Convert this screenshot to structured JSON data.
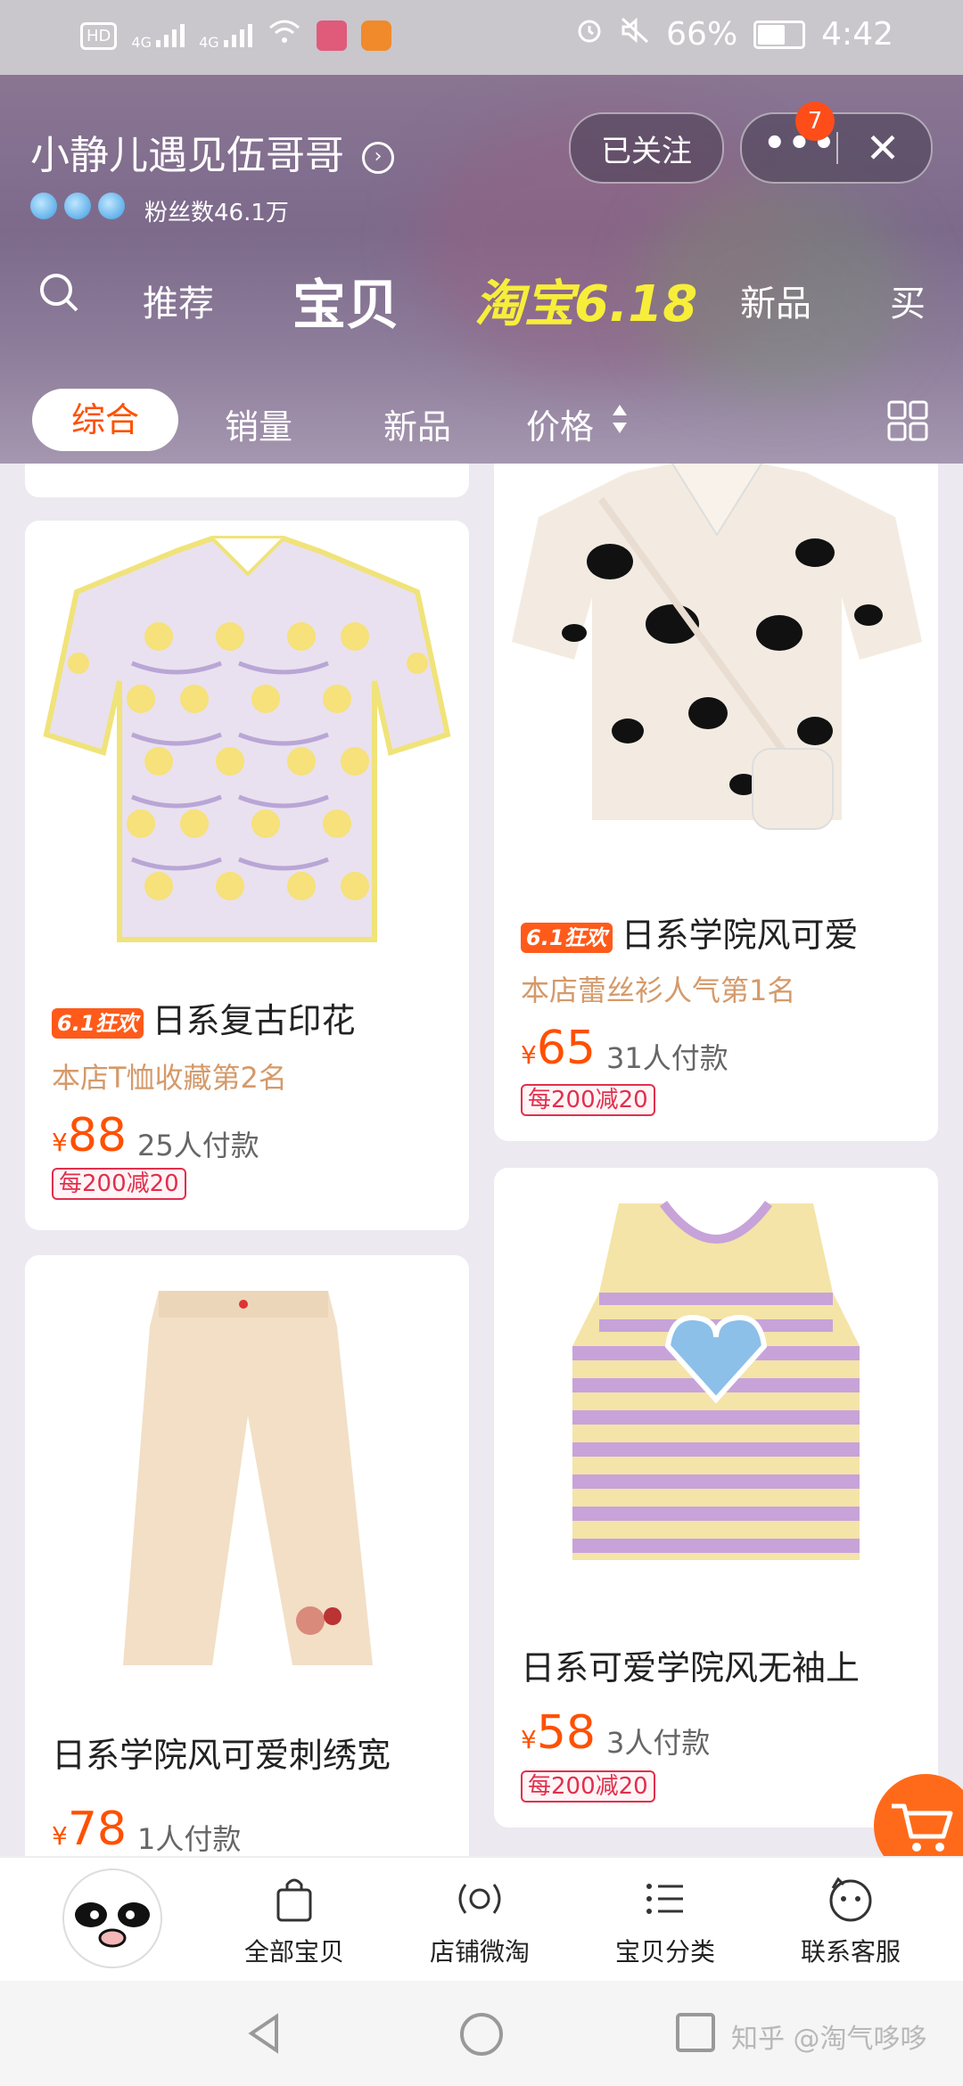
{
  "status_bar": {
    "hd": "HD",
    "net1": "4G",
    "net2": "4G",
    "battery": "66%",
    "time": "4:42"
  },
  "shop": {
    "name": "小静儿遇见伍哥哥",
    "fans": "粉丝数46.1万",
    "follow_label": "已关注",
    "more_label": "•••",
    "badge_count": "7",
    "close_label": "✕"
  },
  "tabs": {
    "recommend": "推荐",
    "products": "宝贝",
    "event": "淘宝6.18",
    "new": "新品",
    "buy": "买"
  },
  "sort": {
    "overall": "综合",
    "sales": "销量",
    "new": "新品",
    "price": "价格"
  },
  "products": [
    {
      "promo": "6.1狂欢",
      "title": "日系复古印花",
      "rank": "本店T恤收藏第2名",
      "price": "88",
      "pay": "25人付款",
      "coupon": "每200减20"
    },
    {
      "promo": "6.1狂欢",
      "title": "日系学院风可爱",
      "rank": "本店蕾丝衫人气第1名",
      "price": "65",
      "pay": "31人付款",
      "coupon": "每200减20"
    },
    {
      "title": "日系学院风可爱刺绣宽",
      "price": "78",
      "pay": "1人付款"
    },
    {
      "title": "日系可爱学院风无袖上",
      "price": "58",
      "pay": "3人付款",
      "coupon": "每200减20"
    }
  ],
  "currency": "¥",
  "bottom_nav": {
    "all": "全部宝贝",
    "weitao": "店铺微淘",
    "category": "宝贝分类",
    "service": "联系客服"
  },
  "watermark": "知乎 @淘气哆哆",
  "colors": {
    "accent": "#ff5000",
    "event_yellow": "#f7ee3a",
    "coupon_red": "#e0304d"
  }
}
